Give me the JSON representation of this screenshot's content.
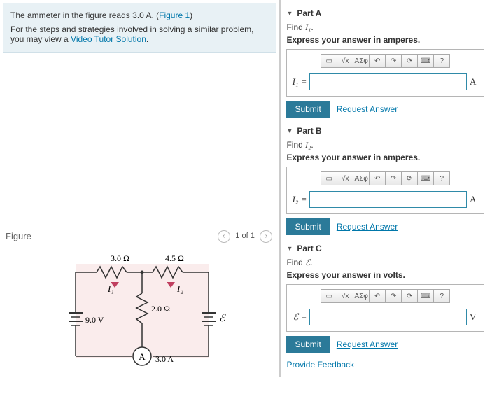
{
  "problem": {
    "text_before_value": "The ammeter in the figure reads ",
    "ammeter_value": "3.0 A",
    "text_after_value": ". (",
    "figure_link": "Figure 1",
    "text_close": ")",
    "strategy_text_1": "For the steps and strategies involved in solving a similar problem, you may view a ",
    "strategy_link": "Video Tutor Solution",
    "strategy_text_2": "."
  },
  "figure": {
    "heading": "Figure",
    "pager_prev": "‹",
    "pager_text": "1 of 1",
    "pager_next": "›",
    "r1_label": "3.0 Ω",
    "r2_label": "4.5 Ω",
    "r3_label": "2.0 Ω",
    "i1_label": "I₁",
    "i2_label": "I₂",
    "v_label": "9.0 V",
    "emf_label": "ℰ",
    "ammeter_symbol": "A",
    "ammeter_reading": "3.0 A"
  },
  "parts": [
    {
      "title": "Part A",
      "find_label": "Find ",
      "find_var": "I₁",
      "find_suffix": ".",
      "instr": "Express your answer in amperes.",
      "eq_label": "I₁ =",
      "unit": "A"
    },
    {
      "title": "Part B",
      "find_label": "Find ",
      "find_var": "I₂",
      "find_suffix": ".",
      "instr": "Express your answer in amperes.",
      "eq_label": "I₂ =",
      "unit": "A"
    },
    {
      "title": "Part C",
      "find_label": "Find ",
      "find_var": "ℰ",
      "find_suffix": ".",
      "instr": "Express your answer in volts.",
      "eq_label": "ℰ =",
      "unit": "V"
    }
  ],
  "tool_icons": [
    "▭",
    "√x",
    "AΣφ",
    "↶",
    "↷",
    "⟳",
    "⌨",
    "?"
  ],
  "buttons": {
    "submit": "Submit",
    "request": "Request Answer",
    "feedback": "Provide Feedback"
  }
}
